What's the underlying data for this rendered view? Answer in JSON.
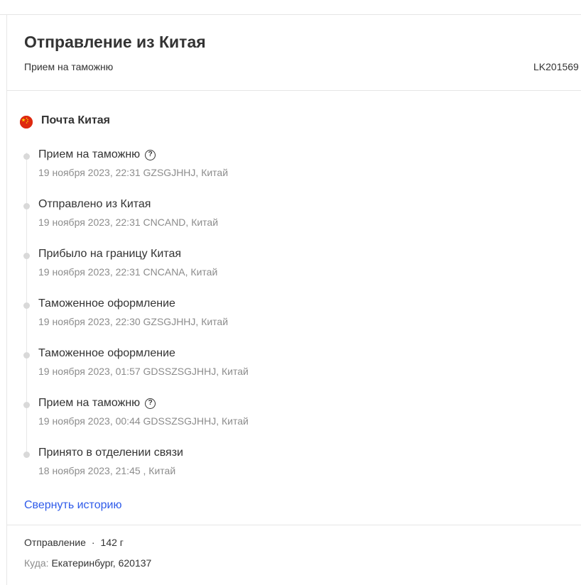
{
  "header": {
    "title": "Отправление из Китая",
    "subtitle": "Прием на таможню",
    "tracking_number": "LK201569"
  },
  "carrier": {
    "name": "Почта Китая",
    "flag_icon": "china-flag-icon"
  },
  "events": [
    {
      "status": "Прием на таможню",
      "meta": "19 ноября 2023, 22:31 GZSGJHHJ, Китай",
      "help": true
    },
    {
      "status": "Отправлено из Китая",
      "meta": "19 ноября 2023, 22:31 CNCAND, Китай",
      "help": false
    },
    {
      "status": "Прибыло на границу Китая",
      "meta": "19 ноября 2023, 22:31 CNCANA, Китай",
      "help": false
    },
    {
      "status": "Таможенное оформление",
      "meta": "19 ноября 2023, 22:30 GZSGJHHJ, Китай",
      "help": false
    },
    {
      "status": "Таможенное оформление",
      "meta": "19 ноября 2023, 01:57 GDSSZSGJHHJ, Китай",
      "help": false
    },
    {
      "status": "Прием на таможню",
      "meta": "19 ноября 2023, 00:44 GDSSZSGJHHJ, Китай",
      "help": true
    },
    {
      "status": "Принято в отделении связи",
      "meta": "18 ноября 2023, 21:45 , Китай",
      "help": false
    }
  ],
  "help_icon_glyph": "?",
  "collapse_label": "Свернуть историю",
  "shipment": {
    "type_label": "Отправление",
    "separator": "·",
    "weight": "142 г",
    "destination_label": "Куда:",
    "destination_value": "Екатеринбург, 620137"
  },
  "colors": {
    "text": "#333333",
    "muted": "#8c8c8c",
    "link": "#2f5bea",
    "divider": "#e6e6e6",
    "flag_red": "#de2910",
    "flag_yellow": "#ffde00"
  }
}
